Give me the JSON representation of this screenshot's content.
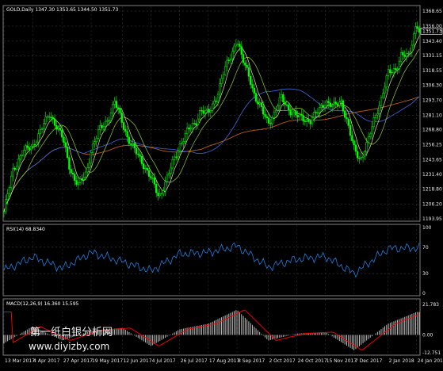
{
  "chart_data": [
    {
      "type": "candlestick",
      "panel": "price",
      "title": "GOLD,Daily  1347.30 1353.65 1344.50 1351.73",
      "last_price": 1351.73,
      "y_ticks": [
        "1368.65",
        "1356.00",
        "1343.40",
        "1331.15",
        "1318.55",
        "1306.30",
        "1293.70",
        "1281.10",
        "1268.80",
        "1256.25",
        "1243.65",
        "1231.40",
        "1218.80",
        "1206.20",
        "1193.95"
      ],
      "ylim": [
        1193.95,
        1368.65
      ],
      "x_ticks": [
        "13 Mar 2017",
        "4 Apr 2017",
        "27 Apr 2017",
        "19 May 2017",
        "12 Jun 2017",
        "4 Jul 2017",
        "26 Jul 2017",
        "17 Aug 2017",
        "8 Sep 2017",
        "2 Oct 2017",
        "24 Oct 2017",
        "15 Nov 2017",
        "7 Dec 2017",
        "2 Jan 2018",
        "24 Jan 2018"
      ],
      "close_path": [
        [
          "13 Mar 2017",
          1200
        ],
        [
          "20 Mar 2017",
          1235
        ],
        [
          "27 Mar 2017",
          1250
        ],
        [
          "4 Apr 2017",
          1255
        ],
        [
          "10 Apr 2017",
          1268
        ],
        [
          "17 Apr 2017",
          1282
        ],
        [
          "21 Apr 2017",
          1275
        ],
        [
          "27 Apr 2017",
          1262
        ],
        [
          "3 May 2017",
          1235
        ],
        [
          "9 May 2017",
          1222
        ],
        [
          "15 May 2017",
          1232
        ],
        [
          "19 May 2017",
          1252
        ],
        [
          "25 May 2017",
          1268
        ],
        [
          "1 Jun 2017",
          1278
        ],
        [
          "6 Jun 2017",
          1292
        ],
        [
          "12 Jun 2017",
          1275
        ],
        [
          "16 Jun 2017",
          1262
        ],
        [
          "21 Jun 2017",
          1252
        ],
        [
          "27 Jun 2017",
          1242
        ],
        [
          "4 Jul 2017",
          1228
        ],
        [
          "10 Jul 2017",
          1212
        ],
        [
          "14 Jul 2017",
          1222
        ],
        [
          "19 Jul 2017",
          1236
        ],
        [
          "26 Jul 2017",
          1256
        ],
        [
          "1 Aug 2017",
          1268
        ],
        [
          "7 Aug 2017",
          1274
        ],
        [
          "11 Aug 2017",
          1286
        ],
        [
          "17 Aug 2017",
          1282
        ],
        [
          "23 Aug 2017",
          1296
        ],
        [
          "29 Aug 2017",
          1318
        ],
        [
          "4 Sep 2017",
          1333
        ],
        [
          "8 Sep 2017",
          1346
        ],
        [
          "12 Sep 2017",
          1328
        ],
        [
          "18 Sep 2017",
          1312
        ],
        [
          "22 Sep 2017",
          1296
        ],
        [
          "28 Sep 2017",
          1283
        ],
        [
          "2 Oct 2017",
          1275
        ],
        [
          "6 Oct 2017",
          1281
        ],
        [
          "12 Oct 2017",
          1296
        ],
        [
          "18 Oct 2017",
          1286
        ],
        [
          "24 Oct 2017",
          1280
        ],
        [
          "30 Oct 2017",
          1278
        ],
        [
          "3 Nov 2017",
          1276
        ],
        [
          "9 Nov 2017",
          1284
        ],
        [
          "15 Nov 2017",
          1293
        ],
        [
          "21 Nov 2017",
          1288
        ],
        [
          "27 Nov 2017",
          1293
        ],
        [
          "1 Dec 2017",
          1278
        ],
        [
          "7 Dec 2017",
          1252
        ],
        [
          "12 Dec 2017",
          1244
        ],
        [
          "18 Dec 2017",
          1260
        ],
        [
          "22 Dec 2017",
          1276
        ],
        [
          "28 Dec 2017",
          1296
        ],
        [
          "2 Jan 2018",
          1316
        ],
        [
          "8 Jan 2018",
          1320
        ],
        [
          "12 Jan 2018",
          1332
        ],
        [
          "18 Jan 2018",
          1330
        ],
        [
          "24 Jan 2018",
          1360
        ],
        [
          "26 Jan 2018",
          1351.73
        ]
      ],
      "series": [
        {
          "color": "#00ff00",
          "role": "candles"
        },
        {
          "color": "#e6e6a0",
          "role": "fast moving average"
        },
        {
          "color": "#9acd32",
          "role": "medium moving average"
        },
        {
          "color": "#4169e1",
          "role": "slow moving average"
        },
        {
          "color": "#d2691e",
          "role": "long moving average"
        }
      ]
    },
    {
      "type": "line",
      "panel": "rsi",
      "title": "RSI(14) 68.8340",
      "y_ticks": [
        "100",
        "70",
        "30",
        "0"
      ],
      "ylim": [
        0,
        100
      ],
      "levels": [
        70,
        30
      ],
      "color": "#1e90ff",
      "path": [
        [
          "13 Mar 2017",
          35
        ],
        [
          "4 Apr 2017",
          55
        ],
        [
          "27 Apr 2017",
          38
        ],
        [
          "19 May 2017",
          62
        ],
        [
          "12 Jun 2017",
          48
        ],
        [
          "4 Jul 2017",
          34
        ],
        [
          "26 Jul 2017",
          60
        ],
        [
          "17 Aug 2017",
          62
        ],
        [
          "8 Sep 2017",
          72
        ],
        [
          "2 Oct 2017",
          40
        ],
        [
          "24 Oct 2017",
          52
        ],
        [
          "15 Nov 2017",
          56
        ],
        [
          "7 Dec 2017",
          30
        ],
        [
          "2 Jan 2018",
          68
        ],
        [
          "24 Jan 2018",
          69
        ]
      ]
    },
    {
      "type": "histogram",
      "panel": "macd",
      "title": "MACD(12,26,9) 16.360 15.595",
      "y_ticks": [
        "21.783",
        "0.00",
        "-12.751"
      ],
      "ylim": [
        -12.751,
        21.783
      ],
      "histogram_color": "#c0c0c0",
      "signal_color": "#ff0000",
      "path": [
        [
          "13 Mar 2017",
          -6
        ],
        [
          "4 Apr 2017",
          6
        ],
        [
          "27 Apr 2017",
          -4
        ],
        [
          "19 May 2017",
          3
        ],
        [
          "12 Jun 2017",
          5
        ],
        [
          "4 Jul 2017",
          -8
        ],
        [
          "26 Jul 2017",
          4
        ],
        [
          "17 Aug 2017",
          8
        ],
        [
          "8 Sep 2017",
          18
        ],
        [
          "2 Oct 2017",
          -4
        ],
        [
          "24 Oct 2017",
          1
        ],
        [
          "15 Nov 2017",
          2
        ],
        [
          "7 Dec 2017",
          -11
        ],
        [
          "2 Jan 2018",
          8
        ],
        [
          "24 Jan 2018",
          16.36
        ]
      ]
    }
  ],
  "watermark": {
    "line1": "第一纸白银分析网",
    "line2": "www.diyizby.com"
  }
}
